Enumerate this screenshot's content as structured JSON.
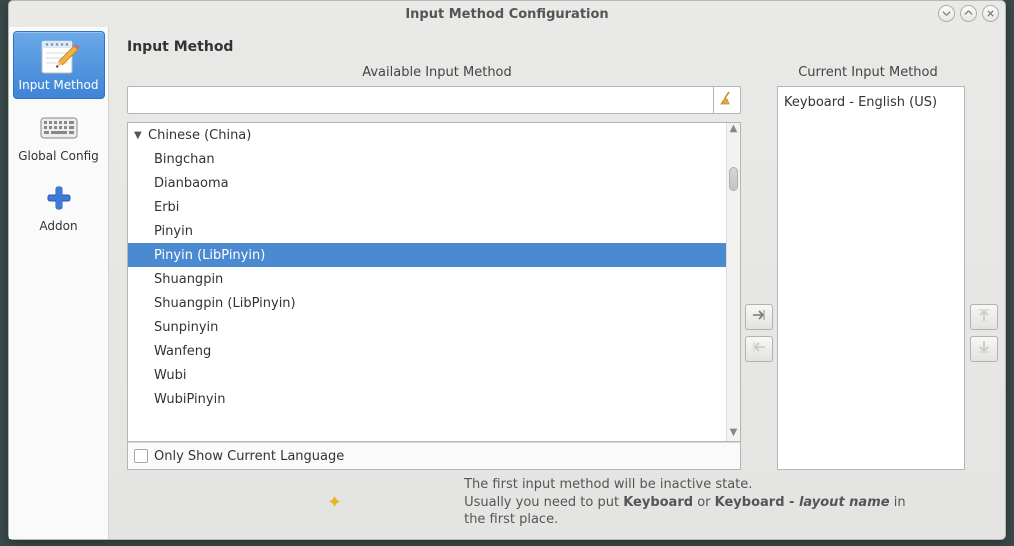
{
  "window": {
    "title": "Input Method Configuration"
  },
  "sidebar": {
    "items": [
      {
        "key": "input-method",
        "label": "Input Method",
        "selected": true
      },
      {
        "key": "global-config",
        "label": "Global Config",
        "selected": false
      },
      {
        "key": "addon",
        "label": "Addon",
        "selected": false
      }
    ]
  },
  "page": {
    "title": "Input Method"
  },
  "columns": {
    "available": "Available Input Method",
    "current": "Current Input Method"
  },
  "search": {
    "value": ""
  },
  "available": {
    "group": "Chinese (China)",
    "items": [
      "Bingchan",
      "Dianbaoma",
      "Erbi",
      "Pinyin",
      "Pinyin (LibPinyin)",
      "Shuangpin",
      "Shuangpin (LibPinyin)",
      "Sunpinyin",
      "Wanfeng",
      "Wubi",
      "WubiPinyin"
    ],
    "selected": "Pinyin (LibPinyin)"
  },
  "only_current": {
    "label": "Only Show Current Language",
    "checked": false
  },
  "current": {
    "items": [
      "Keyboard - English (US)"
    ]
  },
  "hint": {
    "line1": "The first input method will be inactive state.",
    "line2a": "Usually you need to put ",
    "kb": "Keyboard",
    "or": " or ",
    "kb2": "Keyboard - ",
    "layout": "layout name",
    "line2b": " in the first place."
  }
}
